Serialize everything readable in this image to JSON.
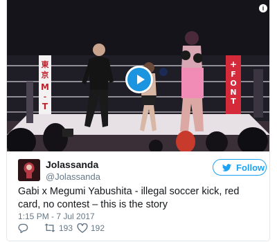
{
  "tweet": {
    "author_name": "Jolassanda",
    "author_handle": "@Jolassanda",
    "follow_label": "Follow",
    "text": "Gabi x Megumi Yabushita - illegal soccer kick, red card, no contest – this is the story",
    "timestamp": "1:15 PM - 7 Jul 2017",
    "retweet_count": "193",
    "like_count": "192"
  },
  "video": {
    "banner_left": "東京M-T",
    "banner_right": "FONT",
    "play_icon": "play-icon",
    "info_icon": "info-icon"
  },
  "colors": {
    "accent": "#1da1f2",
    "play_button": "#1b95e0",
    "text": "#14171a",
    "muted": "#657786"
  }
}
